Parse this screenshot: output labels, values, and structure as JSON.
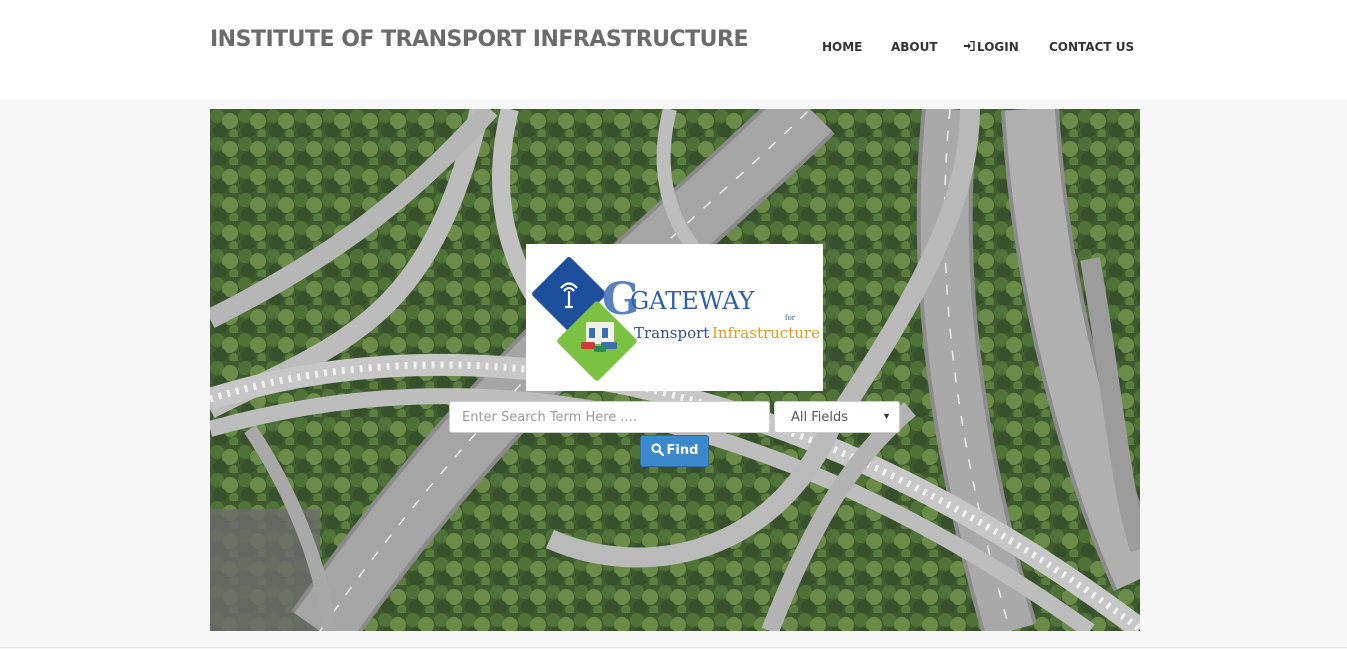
{
  "header": {
    "site_title": "INSTITUTE OF TRANSPORT INFRASTRUCTURE",
    "nav": {
      "home": "HOME",
      "about": "ABOUT",
      "login": "LOGIN",
      "contact": "CONTACT US"
    }
  },
  "logo": {
    "word_main": "GATEWAY",
    "word_for": "for",
    "word_transport": "Transport",
    "word_infrastructure": "Infrastructure"
  },
  "search": {
    "placeholder": "Enter Search Term Here ....",
    "value": "",
    "field_selected": "All Fields",
    "button_label": "Find"
  },
  "icons": {
    "login": "sign-in-icon",
    "find": "search-icon",
    "select": "caret-down-icon"
  },
  "colors": {
    "title": "#6b6b6b",
    "button": "#3b89cc",
    "logo_blue": "#1d4f9c",
    "logo_green": "#7cc242",
    "logo_orange": "#e39a1a"
  }
}
